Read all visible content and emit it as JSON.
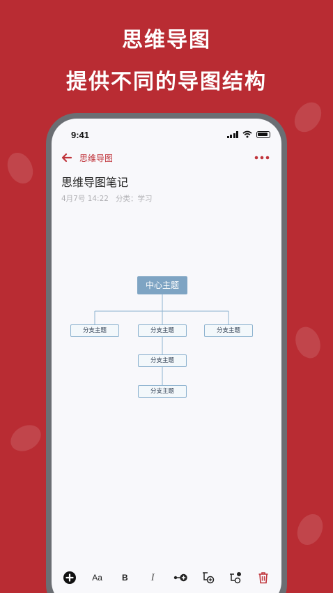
{
  "promo": {
    "title": "思维导图",
    "subtitle": "提供不同的导图结构"
  },
  "status_bar": {
    "time": "9:41"
  },
  "nav": {
    "title": "思维导图"
  },
  "note": {
    "title": "思维导图笔记",
    "date": "4月7号 14:22",
    "category": "分类：学习"
  },
  "mindmap": {
    "center": "中心主题",
    "branches": [
      "分支主题",
      "分支主题",
      "分支主题"
    ],
    "sub_branches": [
      "分支主题",
      "分支主题"
    ]
  },
  "toolbar": {
    "font_label": "Aa",
    "bold_label": "B",
    "italic_label": "I"
  },
  "colors": {
    "background": "#b92c33",
    "accent": "#c0343b",
    "node_fill": "#7ea4c3",
    "node_border": "#8db2cf"
  }
}
